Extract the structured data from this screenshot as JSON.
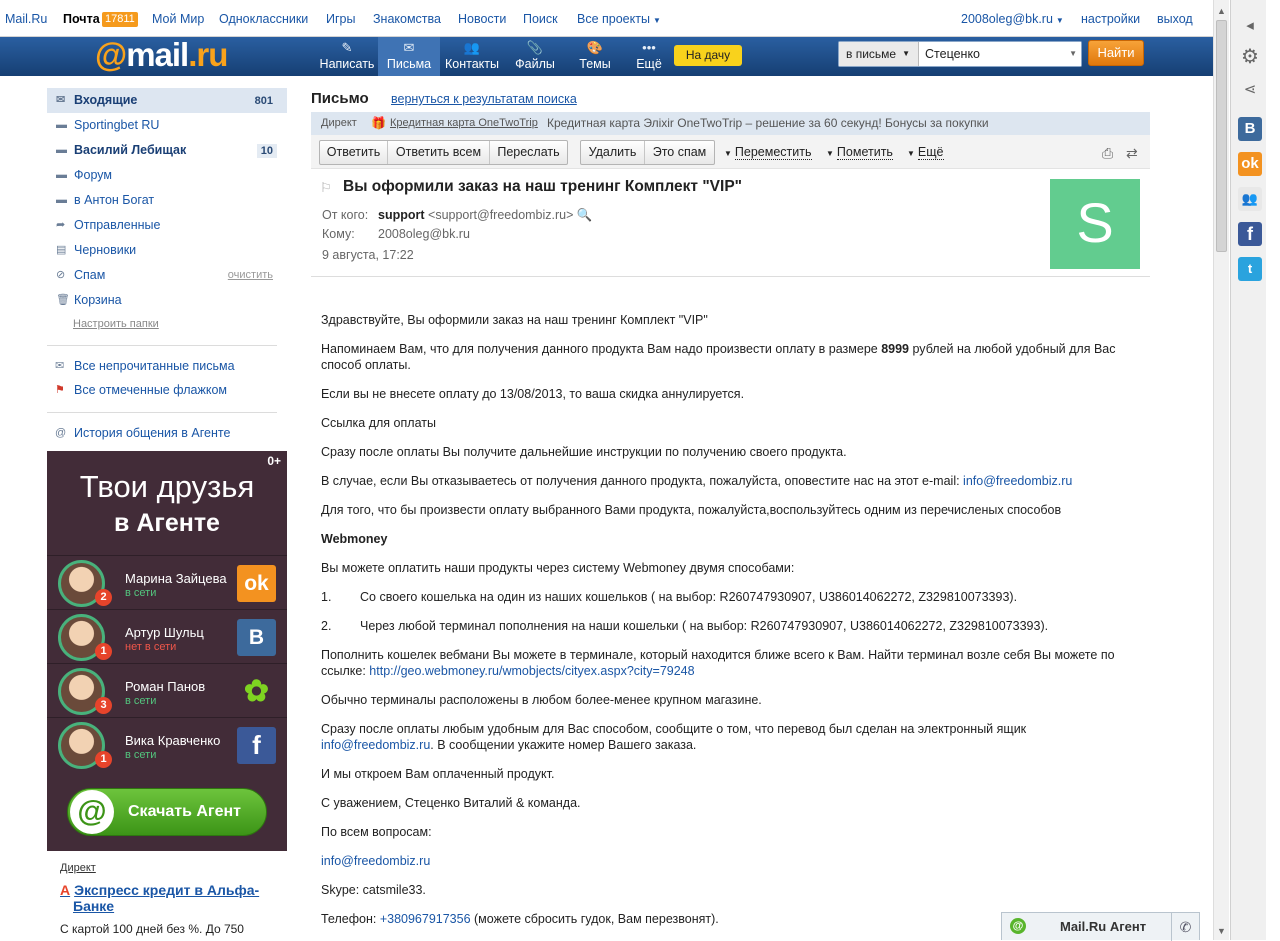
{
  "topnav": {
    "items": [
      "Mail.Ru",
      "Почта",
      "Мой Мир",
      "Одноклассники",
      "Игры",
      "Знакомства",
      "Новости",
      "Поиск",
      "Все проекты"
    ],
    "mail_badge": "17811",
    "account": "2008oleg@bk.ru",
    "settings": "настройки",
    "logout": "выход"
  },
  "header": {
    "logo_at": "@",
    "logo_mail": "mail",
    "logo_ru": ".ru",
    "buttons": [
      {
        "label": "Написать",
        "icon": "pencil-icon"
      },
      {
        "label": "Письма",
        "icon": "envelope-icon"
      },
      {
        "label": "Контакты",
        "icon": "contacts-icon"
      },
      {
        "label": "Файлы",
        "icon": "paperclip-icon"
      },
      {
        "label": "Темы",
        "icon": "palette-icon"
      },
      {
        "label": "Ещё",
        "icon": "more-icon"
      }
    ],
    "promo": "На дачу",
    "search_scope": "в письме",
    "search_value": "Стеценко",
    "search_button": "Найти"
  },
  "sidebar": {
    "folders": [
      {
        "label": "Входящие",
        "count": "801"
      },
      {
        "label": "Sportingbet RU",
        "count": ""
      },
      {
        "label": "Василий Лебищак",
        "count": "10"
      },
      {
        "label": "Форум",
        "count": ""
      },
      {
        "label": "в Антон Богат",
        "count": ""
      },
      {
        "label": "Отправленные",
        "count": ""
      },
      {
        "label": "Черновики",
        "count": ""
      },
      {
        "label": "Спам",
        "count": ""
      },
      {
        "label": "Корзина",
        "count": ""
      }
    ],
    "clean_label": "очистить",
    "setup_folders": "Настроить папки",
    "all_unread": "Все непрочитанные письма",
    "all_flagged": "Все отмеченные флажком",
    "agent_history": "История общения в Агенте"
  },
  "agent_promo": {
    "counter": "0+",
    "title_line1": "Твои друзья",
    "title_line2": "в Агенте",
    "friends": [
      {
        "name": "Марина Зайцева",
        "status": "в сети",
        "badge": "2",
        "network": "Од"
      },
      {
        "name": "Артур Шульц",
        "status": "нет в сети",
        "badge": "1",
        "network": "В"
      },
      {
        "name": "Роман Панов",
        "status": "в сети",
        "badge": "3",
        "network": "✱"
      },
      {
        "name": "Вика Кравченко",
        "status": "в сети",
        "badge": "1",
        "network": "f"
      }
    ],
    "download_label": "Скачать Агент"
  },
  "direct_ad": {
    "label": "Директ",
    "title": "Экспресс кредит в Альфа-Банке",
    "text": "С картой 100 дней без %. До 750"
  },
  "message": {
    "page_title": "Письмо",
    "back_link": "вернуться к результатам поиска",
    "ad_label": "Директ",
    "ad_link": "Кредитная карта OneTwoTrip",
    "ad_text": "Кредитная карта Элixir OneTwoTrip – решение за 60 секунд! Бонусы за покупки",
    "toolbar": {
      "reply": "Ответить",
      "reply_all": "Ответить всем",
      "forward": "Переслать",
      "delete": "Удалить",
      "spam": "Это спам",
      "move": "Переместить",
      "mark": "Пометить",
      "more": "Ещё"
    },
    "subject": "Вы оформили заказ на наш тренинг Комплект \"VIP\"",
    "from_label": "От кого:",
    "from_name": "support",
    "from_email": "<support@freedombiz.ru>",
    "to_label": "Кому:",
    "to_email": "2008oleg@bk.ru",
    "date": "9 августа, 17:22",
    "avatar_letter": "S",
    "body": {
      "p1": "Здравствуйте,  Вы  оформили заказ на наш тренинг Комплект \"VIP\"",
      "p2a": "Напоминаем Вам, что для получения данного продукта Вам надо произвести  оплату в размере ",
      "p2b": "8999",
      "p2c": " рублей на любой удобный для Вас способ оплаты.",
      "p3": "Если вы не внесете оплату до 13/08/2013, то ваша скидка аннулируется.",
      "p4": "Ссылка для оплаты",
      "p5": "Сразу после оплаты Вы получите дальнейшие инструкции по получению своего продукта.",
      "p6": "В случае, если Вы отказываетесь от получения данного продукта, пожалуйста, оповестите нас на этот e-mail: ",
      "email": "info@freedombiz.ru",
      "p7": "Для того, что бы произвести оплату выбранного Вами продукта, пожалуйста,воспользуйтесь одним из перечисленых способов",
      "webmoney": "Webmoney",
      "p8": "Вы можете оплатить наши продукты через систему Webmoney двумя способами:",
      "li1_num": "1.",
      "li1": "Со своего кошелька на один из наших кошельков ( на выбор: R260747930907, U386014062272, Z329810073393).",
      "li2_num": "2.",
      "li2": "Через любой терминал пополнения на наши кошельки ( на выбор: R260747930907, U386014062272, Z329810073393).",
      "p9": "Пополнить кошелек вебмани Вы можете в терминале, который находится ближе всего к Вам. Найти терминал возле себя Вы можете по ссылке: ",
      "geo_link": "http://geo.webmoney.ru/wmobjects/cityex.aspx?city=79248",
      "p10": "Обычно терминалы расположены в любом более-менее крупном магазине.",
      "p11": "Сразу после оплаты любым удобным для Вас способом, сообщите о том, что перевод был сделан на электронный ящик ",
      "p11b": ". В сообщении укажите номер Вашего заказа.",
      "p12": "И мы откроем Вам оплаченный продукт.",
      "p13": "С уважением, Стеценко Виталий & команда.",
      "p14": "По всем вопросам:",
      "skype": "Skype: catsmile33.",
      "phone_label": "Телефон: ",
      "phone": "+380967917356 ",
      "phone_note": "(можете сбросить гудок, Вам перезвонят)."
    }
  },
  "agent_bar": {
    "label": "Mail.Ru Агент"
  },
  "colors": {
    "header_blue": "#1d4f8a",
    "link": "#1a56a6",
    "accent_orange": "#f59a1c",
    "agent_green": "#59b52c",
    "avatar_green": "#62cc8f"
  }
}
